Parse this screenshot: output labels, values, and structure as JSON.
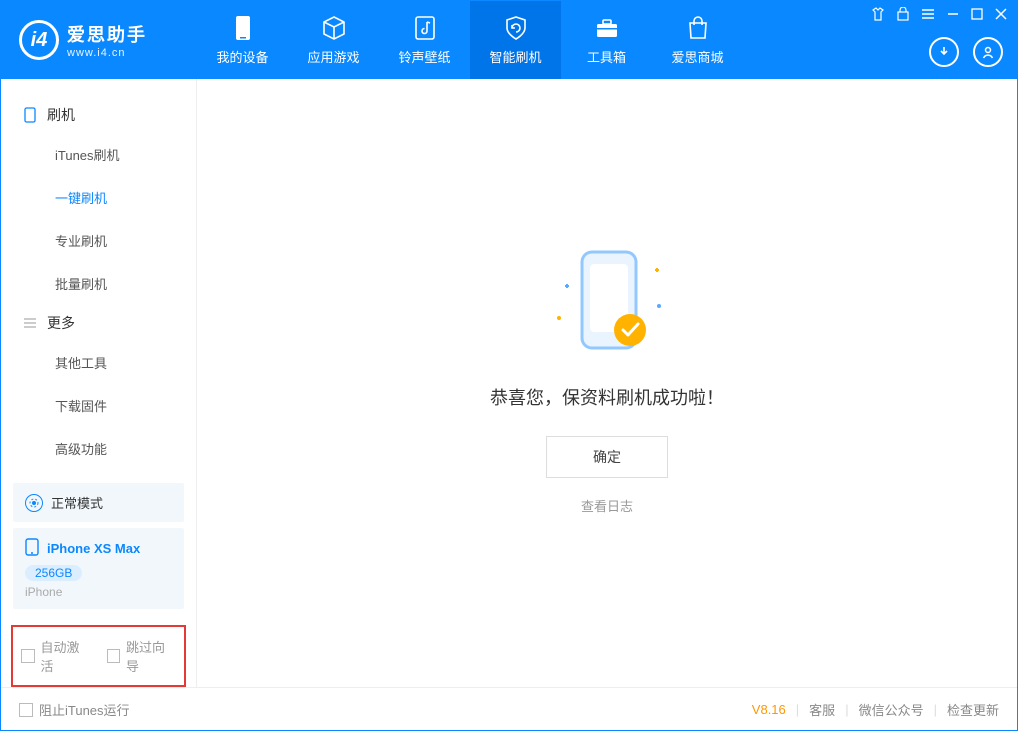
{
  "app": {
    "name_cn": "爱思助手",
    "name_en": "www.i4.cn"
  },
  "nav": {
    "my_device": "我的设备",
    "apps_games": "应用游戏",
    "ring_wall": "铃声壁纸",
    "smart_flash": "智能刷机",
    "toolbox": "工具箱",
    "store": "爱思商城"
  },
  "sidebar": {
    "group_flash": "刷机",
    "itunes_flash": "iTunes刷机",
    "onekey_flash": "一键刷机",
    "pro_flash": "专业刷机",
    "batch_flash": "批量刷机",
    "group_more": "更多",
    "other_tools": "其他工具",
    "download_fw": "下载固件",
    "advanced": "高级功能"
  },
  "device": {
    "mode": "正常模式",
    "name": "iPhone XS Max",
    "capacity": "256GB",
    "type": "iPhone"
  },
  "checks": {
    "auto_activate": "自动激活",
    "skip_guide": "跳过向导"
  },
  "main": {
    "success": "恭喜您，保资料刷机成功啦！",
    "ok": "确定",
    "view_log": "查看日志"
  },
  "footer": {
    "block_itunes": "阻止iTunes运行",
    "version": "V8.16",
    "support": "客服",
    "wechat": "微信公众号",
    "update": "检查更新"
  }
}
